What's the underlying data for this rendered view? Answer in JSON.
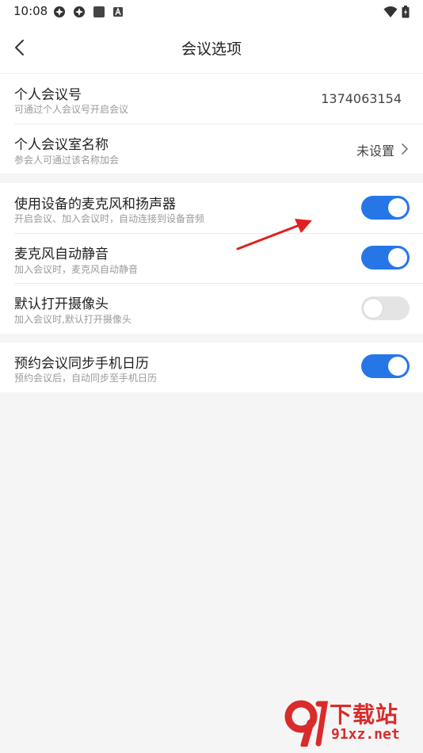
{
  "status_bar": {
    "time": "10:08",
    "icons": [
      "app-icon",
      "app-icon",
      "square-icon",
      "a-badge-icon",
      "wifi-icon",
      "battery-charging-icon"
    ]
  },
  "header": {
    "title": "会议选项",
    "back_icon": "chevron-left-icon"
  },
  "sections": [
    {
      "rows": [
        {
          "title": "个人会议号",
          "subtitle": "可通过个人会议号开启会议",
          "value": "1374063154"
        },
        {
          "title": "个人会议室名称",
          "subtitle": "参会人可通过该名称加会",
          "value": "未设置"
        }
      ]
    },
    {
      "rows": [
        {
          "title": "使用设备的麦克风和扬声器",
          "subtitle": "开启会议、加入会议时，自动连接到设备音频",
          "toggle": true
        },
        {
          "title": "麦克风自动静音",
          "subtitle": "加入会议时，麦克风自动静音",
          "toggle": true
        },
        {
          "title": "默认打开摄像头",
          "subtitle": "加入会议时,默认打开摄像头",
          "toggle": false
        }
      ]
    },
    {
      "rows": [
        {
          "title": "预约会议同步手机日历",
          "subtitle": "预约会议后，自动同步至手机日历",
          "toggle": true
        }
      ]
    }
  ],
  "colors": {
    "accent": "#2676e8",
    "annotation": "#e02020",
    "watermark": "#d92b2b"
  },
  "watermark": {
    "name": "下载站",
    "domain": "91xz.net"
  }
}
